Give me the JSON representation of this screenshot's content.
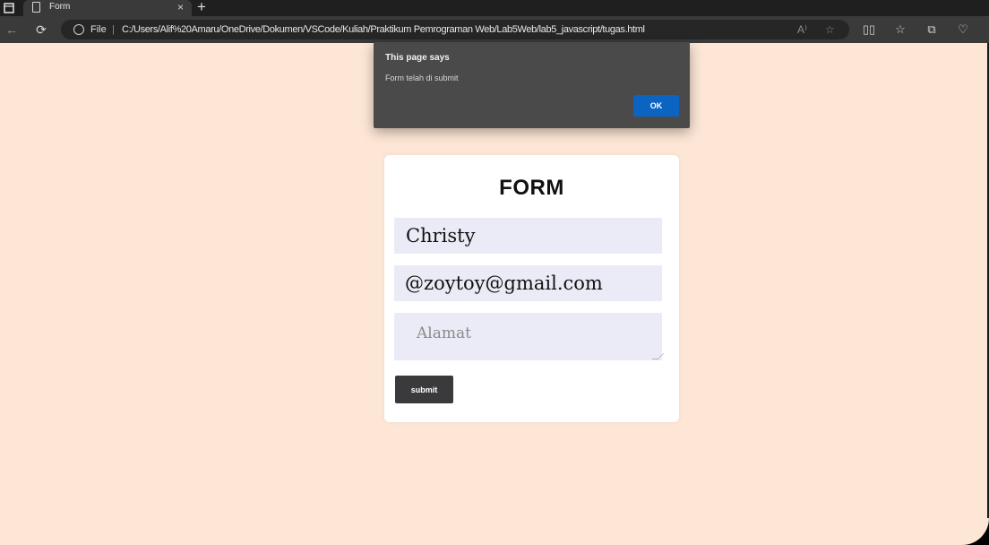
{
  "browser": {
    "tab_actions_icon": "tab-actions-icon",
    "tab": {
      "title": "Form",
      "close_glyph": "×"
    },
    "new_tab_glyph": "+",
    "toolbar": {
      "back_glyph": "←",
      "refresh_glyph": "⟳"
    },
    "address": {
      "scheme": "File",
      "separator": "|",
      "url": "C:/Users/Alif%20Amaru/OneDrive/Dokumen/VSCode/Kuliah/Praktikum Pemrograman Web/Lab5Web/lab5_javascript/tugas.html",
      "read_aloud_glyph": "A⁾",
      "favorite_glyph": "☆"
    },
    "right_icons": {
      "split_screen": "▯▯",
      "favorites": "☆",
      "collections": "⧉",
      "browser_essentials": "♡"
    }
  },
  "form": {
    "title": "FORM",
    "name_value": "Christy",
    "email_value": "@zoytoy@gmail.com",
    "address_placeholder": "Alamat",
    "submit_label": "submit"
  },
  "alert": {
    "title": "This page says",
    "message": "Form telah di submit",
    "ok_label": "OK"
  },
  "colors": {
    "page_background": "#fde6d6",
    "field_background": "#ebebf7",
    "submit_background": "#3a3a3c",
    "dialog_background": "#4a4a4a",
    "ok_button": "#0c64c2"
  }
}
